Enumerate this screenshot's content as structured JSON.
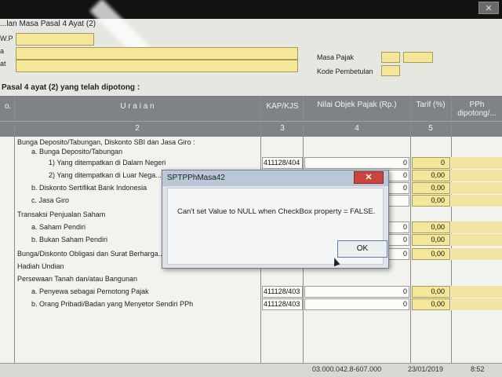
{
  "window": {
    "title": "...lan Masa Pasal 4 Ayat (2)",
    "close_label": "✕"
  },
  "header_form": {
    "label_npwp": "W.P",
    "label_nama": "a",
    "label_alamat": "at",
    "label_masa_pajak": "Masa Pajak",
    "label_kode_pembetulan": "Kode Pembetulan"
  },
  "section_title": "Pasal 4 ayat (2) yang telah dipotong :",
  "table": {
    "headers": {
      "no": "o.",
      "uraian": "U r a i a n",
      "kap": "KAP/KJS",
      "nilai": "Nilai Objek Pajak (Rp.)",
      "tarif": "Tarif (%)",
      "pph": "PPh dipotong/..."
    },
    "numbers": {
      "uraian": "2",
      "kap": "3",
      "nilai": "4",
      "tarif": "5"
    },
    "rows": [
      {
        "text": "Bunga Deposito/Tabungan, Diskonto SBI dan Jasa Giro :",
        "indent": 0
      },
      {
        "text": "a. Bunga Deposito/Tabungan",
        "indent": 1
      },
      {
        "text": "1)  Yang ditempatkan di Dalam Negeri",
        "indent": 2,
        "kap": "411128/404",
        "nilai": "0",
        "tarif": "0"
      },
      {
        "text": "2)  Yang ditempatkan di Luar Nega...",
        "indent": 2,
        "kap": "",
        "nilai": "0",
        "tarif": "0,00"
      },
      {
        "text": "b. Diskonto Sertifikat Bank Indonesia",
        "indent": 1,
        "kap": "",
        "nilai": "0",
        "tarif": "0,00"
      },
      {
        "text": "c. Jasa Giro",
        "indent": 1,
        "kap": "",
        "nilai": "",
        "tarif": "0,00"
      },
      {
        "text": "Transaksi Penjualan Saham",
        "indent": 0
      },
      {
        "text": "a. Saham Pendiri",
        "indent": 1,
        "kap": "",
        "nilai": "0",
        "tarif": "0,00"
      },
      {
        "text": "b. Bukan Saham Pendiri",
        "indent": 1,
        "kap": "",
        "nilai": "0",
        "tarif": "0,00"
      },
      {
        "text": "Bunga/Diskonto Obligasi dan Surat Berharga...",
        "indent": 0,
        "kap": "",
        "nilai": "0",
        "tarif": "0,00"
      },
      {
        "text": "Hadiah Undian",
        "indent": 0
      },
      {
        "text": "Persewaan Tanah dan/atau Bangunan",
        "indent": 0
      },
      {
        "text": "a. Penyewa sebagai Pemotong Pajak",
        "indent": 1,
        "kap": "411128/403",
        "nilai": "0",
        "tarif": "0,00"
      },
      {
        "text": "b. Orang Pribadi/Badan yang Menyetor Sendiri PPh",
        "indent": 1,
        "kap": "411128/403",
        "nilai": "0",
        "tarif": "0,00"
      }
    ]
  },
  "status_bar": {
    "npwp": "03.000.042.8-607.000",
    "date": "23/01/2019",
    "time": "8:52"
  },
  "dialog": {
    "title": "SPTPPhMasa42",
    "close_label": "✕",
    "message": "Can't set Value to NULL when CheckBox property = FALSE.",
    "ok_label": "OK"
  },
  "colors": {
    "field_yellow": "#f5e79a",
    "header_gray": "#7f8387",
    "dialog_close_red": "#c8443c"
  }
}
